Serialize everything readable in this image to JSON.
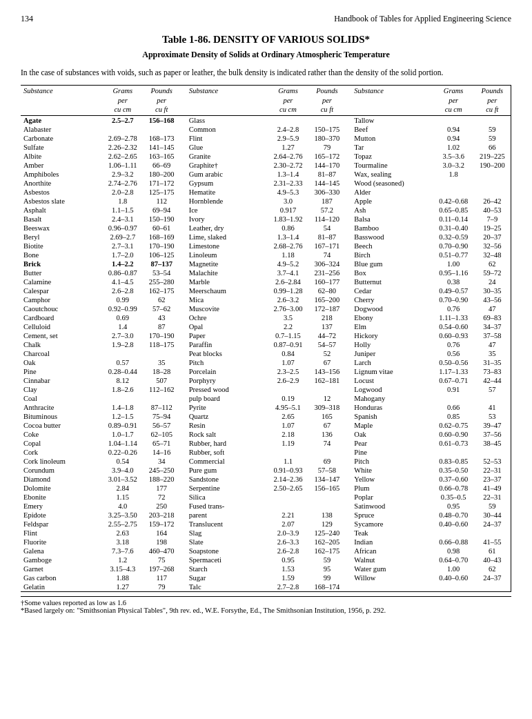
{
  "page": {
    "number": "134",
    "header": "Handbook of Tables for Applied Engineering Science"
  },
  "table": {
    "title": "Table 1-86.   DENSITY OF VARIOUS SOLIDS*",
    "subtitle": "Approximate Density of Solids at Ordinary Atmospheric Temperature",
    "intro": "In the case of substances with voids, such as paper or leather, the bulk density is indicated rather than the density of the solid portion."
  },
  "columns": {
    "substance": "Substance",
    "grams": "Grams per cu cm",
    "pounds": "Pounds per cu ft"
  },
  "footnotes": [
    "†Some values reported as low as 1.6",
    "*Based largely on: \"Smithsonian Physical Tables\", 9th rev. ed., W.E. Forsythe, Ed., The Smithsonian Institution, 1956, p. 292."
  ],
  "rows_col1": [
    {
      "substance": "Agate",
      "grams": "2.5–2.7",
      "pounds": "156–168",
      "bold": true
    },
    {
      "substance": "Alabaster",
      "grams": "",
      "pounds": ""
    },
    {
      "substance": "  Carbonate",
      "grams": "2.69–2.78",
      "pounds": "168–173"
    },
    {
      "substance": "  Sulfate",
      "grams": "2.26–2.32",
      "pounds": "141–145"
    },
    {
      "substance": "Albite",
      "grams": "2.62–2.65",
      "pounds": "163–165"
    },
    {
      "substance": "Amber",
      "grams": "1.06–1.11",
      "pounds": "66–69"
    },
    {
      "substance": "Amphiboles",
      "grams": "2.9–3.2",
      "pounds": "180–200"
    },
    {
      "substance": "Anorthite",
      "grams": "2.74–2.76",
      "pounds": "171–172"
    },
    {
      "substance": "Asbestos",
      "grams": "2.0–2.8",
      "pounds": "125–175"
    },
    {
      "substance": "Asbestos slate",
      "grams": "1.8",
      "pounds": "112"
    },
    {
      "substance": "Asphalt",
      "grams": "1.1–1.5",
      "pounds": "69–94"
    },
    {
      "substance": "Basalt",
      "grams": "2.4–3.1",
      "pounds": "150–190"
    },
    {
      "substance": "Beeswax",
      "grams": "0.96–0.97",
      "pounds": "60–61"
    },
    {
      "substance": "Beryl",
      "grams": "2.69–2.7",
      "pounds": "168–169"
    },
    {
      "substance": "Biotite",
      "grams": "2.7–3.1",
      "pounds": "170–190"
    },
    {
      "substance": "Bone",
      "grams": "1.7–2.0",
      "pounds": "106–125"
    },
    {
      "substance": "Brick",
      "grams": "1.4–2.2",
      "pounds": "87–137",
      "bold": true
    },
    {
      "substance": "Butter",
      "grams": "0.86–0.87",
      "pounds": "53–54"
    },
    {
      "substance": "Calamine",
      "grams": "4.1–4.5",
      "pounds": "255–280"
    },
    {
      "substance": "Calespar",
      "grams": "2.6–2.8",
      "pounds": "162–175"
    },
    {
      "substance": "Camphor",
      "grams": "0.99",
      "pounds": "62"
    },
    {
      "substance": "Caoutchouc",
      "grams": "0.92–0.99",
      "pounds": "57–62"
    },
    {
      "substance": "Cardboard",
      "grams": "0.69",
      "pounds": "43"
    },
    {
      "substance": "Celluloid",
      "grams": "1.4",
      "pounds": "87"
    },
    {
      "substance": "Cement, set",
      "grams": "2.7–3.0",
      "pounds": "170–190"
    },
    {
      "substance": "Chalk",
      "grams": "1.9–2.8",
      "pounds": "118–175"
    },
    {
      "substance": "Charcoal",
      "grams": "",
      "pounds": ""
    },
    {
      "substance": "  Oak",
      "grams": "0.57",
      "pounds": "35"
    },
    {
      "substance": "  Pine",
      "grams": "0.28–0.44",
      "pounds": "18–28"
    },
    {
      "substance": "Cinnabar",
      "grams": "8.12",
      "pounds": "507"
    },
    {
      "substance": "Clay",
      "grams": "1.8–2.6",
      "pounds": "112–162"
    },
    {
      "substance": "Coal",
      "grams": "",
      "pounds": ""
    },
    {
      "substance": "  Anthracite",
      "grams": "1.4–1.8",
      "pounds": "87–112"
    },
    {
      "substance": "  Bituminous",
      "grams": "1.2–1.5",
      "pounds": "75–94"
    },
    {
      "substance": "Cocoa butter",
      "grams": "0.89–0.91",
      "pounds": "56–57"
    },
    {
      "substance": "Coke",
      "grams": "1.0–1.7",
      "pounds": "62–105"
    },
    {
      "substance": "Copal",
      "grams": "1.04–1.14",
      "pounds": "65–71"
    },
    {
      "substance": "Cork",
      "grams": "0.22–0.26",
      "pounds": "14–16"
    },
    {
      "substance": "Cork linoleum",
      "grams": "0.54",
      "pounds": "34"
    },
    {
      "substance": "Corundum",
      "grams": "3.9–4.0",
      "pounds": "245–250"
    },
    {
      "substance": "Diamond",
      "grams": "3.01–3.52",
      "pounds": "188–220"
    },
    {
      "substance": "Dolomite",
      "grams": "2.84",
      "pounds": "177"
    },
    {
      "substance": "Ebonite",
      "grams": "1.15",
      "pounds": "72"
    },
    {
      "substance": "Emery",
      "grams": "4.0",
      "pounds": "250"
    },
    {
      "substance": "Epidote",
      "grams": "3.25–3.50",
      "pounds": "203–218"
    },
    {
      "substance": "Feldspar",
      "grams": "2.55–2.75",
      "pounds": "159–172"
    },
    {
      "substance": "Flint",
      "grams": "2.63",
      "pounds": "164"
    },
    {
      "substance": "Fluorite",
      "grams": "3.18",
      "pounds": "198"
    },
    {
      "substance": "Galena",
      "grams": "7.3–7.6",
      "pounds": "460–470"
    },
    {
      "substance": "Gamboge",
      "grams": "1.2",
      "pounds": "75"
    },
    {
      "substance": "Garnet",
      "grams": "3.15–4.3",
      "pounds": "197–268"
    },
    {
      "substance": "Gas carbon",
      "grams": "1.88",
      "pounds": "117"
    },
    {
      "substance": "Gelatin",
      "grams": "1.27",
      "pounds": "79"
    }
  ],
  "rows_col2": [
    {
      "substance": "Glass",
      "grams": "",
      "pounds": ""
    },
    {
      "substance": "  Common",
      "grams": "2.4–2.8",
      "pounds": "150–175"
    },
    {
      "substance": "  Flint",
      "grams": "2.9–5.9",
      "pounds": "180–370"
    },
    {
      "substance": "Glue",
      "grams": "1.27",
      "pounds": "79"
    },
    {
      "substance": "Granite",
      "grams": "2.64–2.76",
      "pounds": "165–172"
    },
    {
      "substance": "Graphite†",
      "grams": "2.30–2.72",
      "pounds": "144–170"
    },
    {
      "substance": "Gum arabic",
      "grams": "1.3–1.4",
      "pounds": "81–87"
    },
    {
      "substance": "Gypsum",
      "grams": "2.31–2.33",
      "pounds": "144–145"
    },
    {
      "substance": "Hematite",
      "grams": "4.9–5.3",
      "pounds": "306–330"
    },
    {
      "substance": "Hornblende",
      "grams": "3.0",
      "pounds": "187"
    },
    {
      "substance": "Ice",
      "grams": "0.917",
      "pounds": "57.2"
    },
    {
      "substance": "Ivory",
      "grams": "1.83–1.92",
      "pounds": "114–120"
    },
    {
      "substance": "Leather, dry",
      "grams": "0.86",
      "pounds": "54"
    },
    {
      "substance": "Lime, slaked",
      "grams": "1.3–1.4",
      "pounds": "81–87"
    },
    {
      "substance": "Limestone",
      "grams": "2.68–2.76",
      "pounds": "167–171"
    },
    {
      "substance": "Linoleum",
      "grams": "1.18",
      "pounds": "74"
    },
    {
      "substance": "Magnetite",
      "grams": "4.9–5.2",
      "pounds": "306–324"
    },
    {
      "substance": "Malachite",
      "grams": "3.7–4.1",
      "pounds": "231–256"
    },
    {
      "substance": "Marble",
      "grams": "2.6–2.84",
      "pounds": "160–177"
    },
    {
      "substance": "Meerschaum",
      "grams": "0.99–1.28",
      "pounds": "62–80"
    },
    {
      "substance": "Mica",
      "grams": "2.6–3.2",
      "pounds": "165–200"
    },
    {
      "substance": "Muscovite",
      "grams": "2.76–3.00",
      "pounds": "172–187"
    },
    {
      "substance": "Ochre",
      "grams": "3.5",
      "pounds": "218"
    },
    {
      "substance": "Opal",
      "grams": "2.2",
      "pounds": "137"
    },
    {
      "substance": "Paper",
      "grams": "0.7–1.15",
      "pounds": "44–72"
    },
    {
      "substance": "Paraffin",
      "grams": "0.87–0.91",
      "pounds": "54–57"
    },
    {
      "substance": "Peat blocks",
      "grams": "0.84",
      "pounds": "52"
    },
    {
      "substance": "Pitch",
      "grams": "1.07",
      "pounds": "67"
    },
    {
      "substance": "Porcelain",
      "grams": "2.3–2.5",
      "pounds": "143–156"
    },
    {
      "substance": "Porphyry",
      "grams": "2.6–2.9",
      "pounds": "162–181"
    },
    {
      "substance": "Pressed wood",
      "grams": "",
      "pounds": ""
    },
    {
      "substance": "  pulp board",
      "grams": "0.19",
      "pounds": "12"
    },
    {
      "substance": "Pyrite",
      "grams": "4.95–5.1",
      "pounds": "309–318"
    },
    {
      "substance": "Quartz",
      "grams": "2.65",
      "pounds": "165"
    },
    {
      "substance": "Resin",
      "grams": "1.07",
      "pounds": "67"
    },
    {
      "substance": "Rock salt",
      "grams": "2.18",
      "pounds": "136"
    },
    {
      "substance": "Rubber, hard",
      "grams": "1.19",
      "pounds": "74"
    },
    {
      "substance": "Rubber, soft",
      "grams": "",
      "pounds": ""
    },
    {
      "substance": "  Commercial",
      "grams": "1.1",
      "pounds": "69"
    },
    {
      "substance": "  Pure gum",
      "grams": "0.91–0.93",
      "pounds": "57–58"
    },
    {
      "substance": "Sandstone",
      "grams": "2.14–2.36",
      "pounds": "134–147"
    },
    {
      "substance": "Serpentine",
      "grams": "2.50–2.65",
      "pounds": "156–165"
    },
    {
      "substance": "Silica",
      "grams": "",
      "pounds": ""
    },
    {
      "substance": "  Fused trans-",
      "grams": "",
      "pounds": ""
    },
    {
      "substance": "    parent",
      "grams": "2.21",
      "pounds": "138"
    },
    {
      "substance": "  Translucent",
      "grams": "2.07",
      "pounds": "129"
    },
    {
      "substance": "Slag",
      "grams": "2.0–3.9",
      "pounds": "125–240"
    },
    {
      "substance": "Slate",
      "grams": "2.6–3.3",
      "pounds": "162–205"
    },
    {
      "substance": "Soapstone",
      "grams": "2.6–2.8",
      "pounds": "162–175"
    },
    {
      "substance": "Spermaceti",
      "grams": "0.95",
      "pounds": "59"
    },
    {
      "substance": "Starch",
      "grams": "1.53",
      "pounds": "95"
    },
    {
      "substance": "Sugar",
      "grams": "1.59",
      "pounds": "99"
    },
    {
      "substance": "Talc",
      "grams": "2.7–2.8",
      "pounds": "168–174"
    }
  ],
  "rows_col3": [
    {
      "substance": "Tallow",
      "grams": "",
      "pounds": ""
    },
    {
      "substance": "  Beef",
      "grams": "0.94",
      "pounds": "59"
    },
    {
      "substance": "  Mutton",
      "grams": "0.94",
      "pounds": "59"
    },
    {
      "substance": "Tar",
      "grams": "1.02",
      "pounds": "66"
    },
    {
      "substance": "Topaz",
      "grams": "3.5–3.6",
      "pounds": "219–225"
    },
    {
      "substance": "Tourmaline",
      "grams": "3.0–3.2",
      "pounds": "190–200"
    },
    {
      "substance": "Wax, sealing",
      "grams": "1.8",
      "pounds": ""
    },
    {
      "substance": "Wood (seasoned)",
      "grams": "",
      "pounds": ""
    },
    {
      "substance": "  Alder",
      "grams": "",
      "pounds": ""
    },
    {
      "substance": "  Apple",
      "grams": "0.42–0.68",
      "pounds": "26–42"
    },
    {
      "substance": "  Ash",
      "grams": "0.65–0.85",
      "pounds": "40–53"
    },
    {
      "substance": "  Balsa",
      "grams": "0.11–0.14",
      "pounds": "7–9"
    },
    {
      "substance": "  Bamboo",
      "grams": "0.31–0.40",
      "pounds": "19–25"
    },
    {
      "substance": "  Basswood",
      "grams": "0.32–0.59",
      "pounds": "20–37"
    },
    {
      "substance": "  Beech",
      "grams": "0.70–0.90",
      "pounds": "32–56"
    },
    {
      "substance": "  Birch",
      "grams": "0.51–0.77",
      "pounds": "32–48"
    },
    {
      "substance": "  Blue gum",
      "grams": "1.00",
      "pounds": "62"
    },
    {
      "substance": "  Box",
      "grams": "0.95–1.16",
      "pounds": "59–72"
    },
    {
      "substance": "  Butternut",
      "grams": "0.38",
      "pounds": "24"
    },
    {
      "substance": "  Cedar",
      "grams": "0.49–0.57",
      "pounds": "30–35"
    },
    {
      "substance": "  Cherry",
      "grams": "0.70–0.90",
      "pounds": "43–56"
    },
    {
      "substance": "  Dogwood",
      "grams": "0.76",
      "pounds": "47"
    },
    {
      "substance": "  Ebony",
      "grams": "1.11–1.33",
      "pounds": "69–83"
    },
    {
      "substance": "  Elm",
      "grams": "0.54–0.60",
      "pounds": "34–37"
    },
    {
      "substance": "  Hickory",
      "grams": "0.60–0.93",
      "pounds": "37–58"
    },
    {
      "substance": "  Holly",
      "grams": "0.76",
      "pounds": "47"
    },
    {
      "substance": "  Juniper",
      "grams": "0.56",
      "pounds": "35"
    },
    {
      "substance": "  Larch",
      "grams": "0.50–0.56",
      "pounds": "31–35"
    },
    {
      "substance": "  Lignum vitae",
      "grams": "1.17–1.33",
      "pounds": "73–83"
    },
    {
      "substance": "  Locust",
      "grams": "0.67–0.71",
      "pounds": "42–44"
    },
    {
      "substance": "  Logwood",
      "grams": "0.91",
      "pounds": "57"
    },
    {
      "substance": "  Mahogany",
      "grams": "",
      "pounds": ""
    },
    {
      "substance": "    Honduras",
      "grams": "0.66",
      "pounds": "41"
    },
    {
      "substance": "    Spanish",
      "grams": "0.85",
      "pounds": "53"
    },
    {
      "substance": "  Maple",
      "grams": "0.62–0.75",
      "pounds": "39–47"
    },
    {
      "substance": "  Oak",
      "grams": "0.60–0.90",
      "pounds": "37–56"
    },
    {
      "substance": "  Pear",
      "grams": "0.61–0.73",
      "pounds": "38–45"
    },
    {
      "substance": "  Pine",
      "grams": "",
      "pounds": ""
    },
    {
      "substance": "    Pitch",
      "grams": "0.83–0.85",
      "pounds": "52–53"
    },
    {
      "substance": "    White",
      "grams": "0.35–0.50",
      "pounds": "22–31"
    },
    {
      "substance": "    Yellow",
      "grams": "0.37–0.60",
      "pounds": "23–37"
    },
    {
      "substance": "  Plum",
      "grams": "0.66–0.78",
      "pounds": "41–49"
    },
    {
      "substance": "  Poplar",
      "grams": "0.35–0.5",
      "pounds": "22–31"
    },
    {
      "substance": "  Satinwood",
      "grams": "0.95",
      "pounds": "59"
    },
    {
      "substance": "  Spruce",
      "grams": "0.48–0.70",
      "pounds": "30–44"
    },
    {
      "substance": "  Sycamore",
      "grams": "0.40–0.60",
      "pounds": "24–37"
    },
    {
      "substance": "  Teak",
      "grams": "",
      "pounds": ""
    },
    {
      "substance": "    Indian",
      "grams": "0.66–0.88",
      "pounds": "41–55"
    },
    {
      "substance": "    African",
      "grams": "0.98",
      "pounds": "61"
    },
    {
      "substance": "  Walnut",
      "grams": "0.64–0.70",
      "pounds": "40–43"
    },
    {
      "substance": "  Water gum",
      "grams": "1.00",
      "pounds": "62"
    },
    {
      "substance": "  Willow",
      "grams": "0.40–0.60",
      "pounds": "24–37"
    }
  ]
}
